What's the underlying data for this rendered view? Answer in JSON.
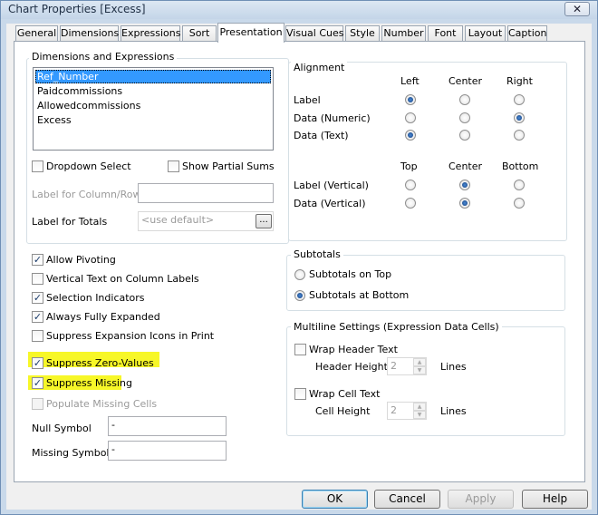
{
  "window": {
    "title": "Chart Properties [Excess]",
    "close_glyph": "✕"
  },
  "tabs": [
    {
      "label": "General"
    },
    {
      "label": "Dimensions"
    },
    {
      "label": "Expressions"
    },
    {
      "label": "Sort"
    },
    {
      "label": "Presentation",
      "active": true
    },
    {
      "label": "Visual Cues"
    },
    {
      "label": "Style"
    },
    {
      "label": "Number"
    },
    {
      "label": "Font"
    },
    {
      "label": "Layout"
    },
    {
      "label": "Caption"
    }
  ],
  "dims": {
    "group_title": "Dimensions and Expressions",
    "items": [
      "Ref_Number",
      "Paidcommissions",
      "Allowedcommissions",
      "Excess"
    ],
    "selected_index": 0,
    "dropdown_select": "Dropdown Select",
    "show_partial_sums": "Show Partial Sums",
    "label_column_row": "Label for Column/Row",
    "label_totals": "Label for Totals",
    "totals_placeholder": "<use default>",
    "browse_label": "..."
  },
  "alignment": {
    "group_title": "Alignment",
    "cols1": [
      "Left",
      "Center",
      "Right"
    ],
    "rows1": [
      "Label",
      "Data (Numeric)",
      "Data (Text)"
    ],
    "selected1": [
      0,
      2,
      0
    ],
    "cols2": [
      "Top",
      "Center",
      "Bottom"
    ],
    "rows2": [
      "Label (Vertical)",
      "Data (Vertical)"
    ],
    "selected2": [
      1,
      1
    ]
  },
  "options": {
    "allow_pivoting": "Allow Pivoting",
    "vertical_text": "Vertical Text on Column Labels",
    "selection_indicators": "Selection Indicators",
    "always_fully_expanded": "Always Fully Expanded",
    "suppress_expansion_icons": "Suppress Expansion Icons in Print",
    "suppress_zero": "Suppress Zero-Values",
    "suppress_missing": "Suppress Missing",
    "populate_missing": "Populate Missing Cells",
    "null_symbol": "Null Symbol",
    "null_value": "-",
    "missing_symbol": "Missing Symbol",
    "missing_value": "-",
    "check_glyph": "✓"
  },
  "subtotals": {
    "group_title": "Subtotals",
    "on_top": "Subtotals on Top",
    "at_bottom": "Subtotals at Bottom"
  },
  "multiline": {
    "group_title": "Multiline Settings (Expression Data Cells)",
    "wrap_header": "Wrap Header Text",
    "header_height": "Header Height",
    "header_value": "2",
    "wrap_cell": "Wrap Cell Text",
    "cell_height": "Cell Height",
    "cell_value": "2",
    "lines": "Lines",
    "up": "▲",
    "down": "▼"
  },
  "buttons": {
    "ok": "OK",
    "cancel": "Cancel",
    "apply": "Apply",
    "help": "Help"
  },
  "colors": {
    "highlight": "#f7f728",
    "selection": "#3399ff"
  }
}
